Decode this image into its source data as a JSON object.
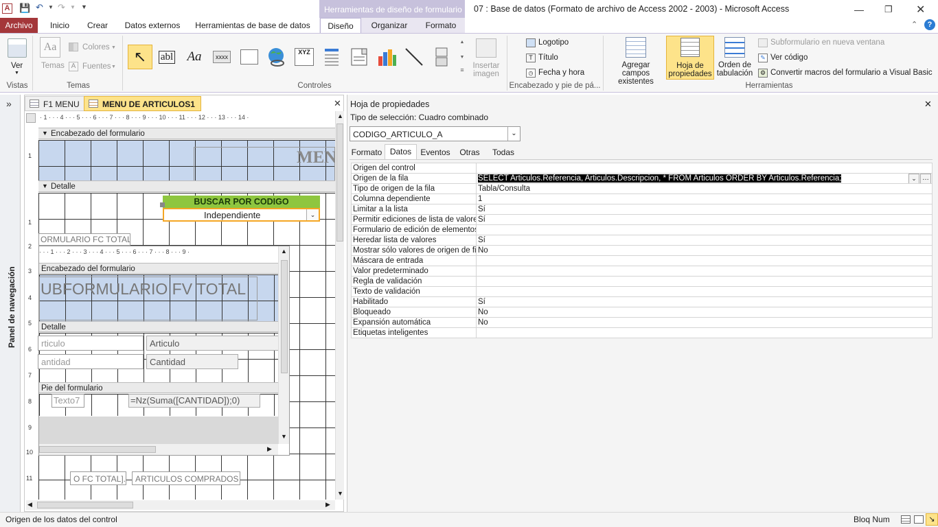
{
  "window": {
    "context_header": "Herramientas de diseño de formulario",
    "title": "07 : Base de datos (Formato de archivo de Access 2002 - 2003)  -  Microsoft Access",
    "app_letter": "A"
  },
  "tabs": [
    "Archivo",
    "Inicio",
    "Crear",
    "Datos externos",
    "Herramientas de base de datos",
    "Diseño",
    "Organizar",
    "Formato"
  ],
  "ribbon": {
    "vistas": {
      "ver": "Ver",
      "label": "Vistas"
    },
    "temas": {
      "temas": "Temas",
      "colores": "Colores",
      "fuentes": "Fuentes",
      "label": "Temas"
    },
    "controles": {
      "insertar_imagen": "Insertar imagen",
      "label": "Controles",
      "textbox": "abl",
      "label_ctl": "Aa",
      "button": "xxxx",
      "xyz": "XYZ"
    },
    "encabezado": {
      "logotipo": "Logotipo",
      "titulo": "Título",
      "fecha_hora": "Fecha y hora",
      "label": "Encabezado y pie de pá..."
    },
    "herramientas": {
      "agregar": "Agregar campos existentes",
      "hoja": "Hoja de propiedades",
      "orden": "Orden de tabulación",
      "subformulario": "Subformulario en nueva ventana",
      "ver_codigo": "Ver código",
      "convertir": "Convertir macros del formulario a Visual Basic",
      "label": "Herramientas"
    }
  },
  "nav_pane": {
    "label": "Panel de navegación",
    "toggle": "»"
  },
  "doc_tabs": [
    "F1 MENU",
    "MENU DE ARTICULOS1"
  ],
  "form": {
    "ruler_h": "· 1 · · · 4 · · · 5 · · · 6 · · · 7 · · · 8 · · · 9 · · · 10 · · · 11 · · · 12 · · · 13 · · · 14 ·",
    "header_section": "Encabezado del formulario",
    "header_title_fragment": "MEN",
    "detail_section": "Detalle",
    "buscar_label": "BUSCAR POR CODIGO",
    "combo_value": "Independiente",
    "fc_total_label": "ORMULARIO FC TOTAL",
    "bottom_ctl1": "O FC TOTAL].[",
    "bottom_ctl2": "ARTICULOS COMPRADOS",
    "vruler": [
      "1",
      "1",
      "2",
      "3",
      "4",
      "5",
      "6",
      "7",
      "8",
      "9",
      "10",
      "11"
    ]
  },
  "subform": {
    "ruler_h": "· · · 1 · · · 2 · · · 3 · · · 4 · · · 5 · · · 6 · · · 7 · · · 8 · · · 9 ·",
    "header_section": "Encabezado del formulario",
    "title": "UBFORMULARIO FV TOTAL",
    "detail_section": "Detalle",
    "art_label": "rticulo",
    "art_field": "Articulo",
    "cant_label": "antidad",
    "cant_field": "Cantidad",
    "footer_section": "Pie del formulario",
    "texto7": "Texto7",
    "nz_formula": "=Nz(Suma([CANTIDAD]);0)"
  },
  "property_sheet": {
    "title": "Hoja de propiedades",
    "selection_type": "Tipo de selección:  Cuadro combinado",
    "object": "CODIGO_ARTICULO_A",
    "tabs": [
      "Formato",
      "Datos",
      "Eventos",
      "Otras",
      "Todas"
    ],
    "active_tab": "Datos",
    "rows": [
      {
        "name": "Origen del control",
        "value": ""
      },
      {
        "name": "Origen de la fila",
        "value": "SELECT Articulos.Referencia, Articulos.Descripcion, * FROM Articulos ORDER BY Articulos.Referencia;"
      },
      {
        "name": "Tipo de origen de la fila",
        "value": "Tabla/Consulta"
      },
      {
        "name": "Columna dependiente",
        "value": "1"
      },
      {
        "name": "Limitar a la lista",
        "value": "Sí"
      },
      {
        "name": "Permitir ediciones de lista de valores",
        "value": "Sí"
      },
      {
        "name": "Formulario de edición de elementos",
        "value": ""
      },
      {
        "name": "Heredar lista de valores",
        "value": "Sí"
      },
      {
        "name": "Mostrar sólo valores de origen de fila",
        "value": "No"
      },
      {
        "name": "Máscara de entrada",
        "value": ""
      },
      {
        "name": "Valor predeterminado",
        "value": ""
      },
      {
        "name": "Regla de validación",
        "value": ""
      },
      {
        "name": "Texto de validación",
        "value": ""
      },
      {
        "name": "Habilitado",
        "value": "Sí"
      },
      {
        "name": "Bloqueado",
        "value": "No"
      },
      {
        "name": "Expansión automática",
        "value": "No"
      },
      {
        "name": "Etiquetas inteligentes",
        "value": ""
      }
    ]
  },
  "status": {
    "left": "Origen de los datos del control",
    "right": "Bloq Num"
  },
  "colors": {
    "archivo": "#a4373a",
    "context": "#c7c1dc",
    "section_blue": "#c7d7ee",
    "buscar_green": "#8ec63f",
    "selection_orange": "#f5a623"
  }
}
